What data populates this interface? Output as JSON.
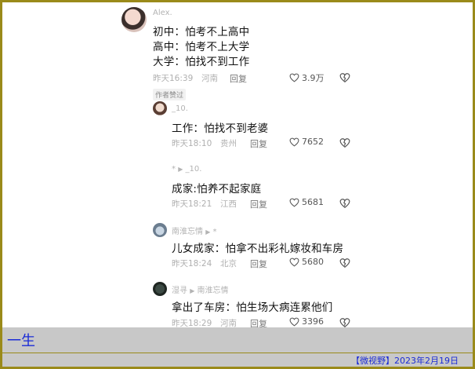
{
  "comments": [
    {
      "user": "Alex.",
      "lines": [
        "初中：怕考不上高中",
        "高中：怕考不上大学",
        "大学：怕找不到工作"
      ],
      "time": "昨天16:39",
      "location": "河南",
      "reply": "回复",
      "likes": "3.9万"
    },
    {
      "badge": "作者赞过",
      "user": "_10.",
      "text": "工作：怕找不到老婆",
      "time": "昨天18:10",
      "location": "贵州",
      "reply": "回复",
      "likes": "7652"
    },
    {
      "user_from": "*",
      "user_to": "_10.",
      "text": "成家:怕养不起家庭",
      "time": "昨天18:21",
      "location": "江西",
      "reply": "回复",
      "likes": "5681"
    },
    {
      "user_from": "南淮忘情",
      "user_to": "*",
      "text": "儿女成家：怕拿不出彩礼嫁妆和车房",
      "time": "昨天18:24",
      "location": "北京",
      "reply": "回复",
      "likes": "5680"
    },
    {
      "user_from": "湿寻",
      "user_to": "南淮忘情",
      "text": "拿出了车房：怕生场大病连累他们",
      "time": "昨天18:29",
      "location": "河南",
      "reply": "回复",
      "likes": "3396"
    }
  ],
  "icons": {
    "like": "heart-outline-icon",
    "dislike": "broken-heart-icon"
  },
  "caption": {
    "title": "一生",
    "credit": "【微视野】2023年2月19日"
  },
  "colors": {
    "frame": "#9a8a1a",
    "caption_text": "#1a2bd6",
    "caption_bg": "#c8c8c8"
  }
}
